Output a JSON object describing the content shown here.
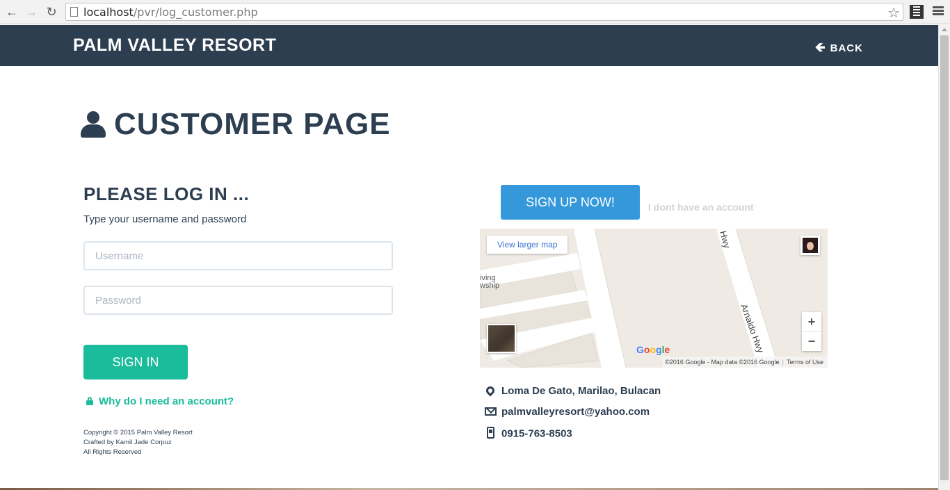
{
  "browser": {
    "url_host": "localhost",
    "url_path": "/pvr/log_customer.php"
  },
  "header": {
    "brand": "PALM VALLEY RESORT",
    "back_label": "BACK"
  },
  "page": {
    "title": "CUSTOMER PAGE"
  },
  "login": {
    "heading": "PLEASE LOG IN ...",
    "subtitle": "Type your username and password",
    "username_placeholder": "Username",
    "password_placeholder": "Password",
    "signin_label": "SIGN IN",
    "why_link": "Why do I need an account?"
  },
  "footer": {
    "line1": "Copyright © 2015 Palm Valley Resort",
    "line2": "Crafted by Kamil Jade Corpuz",
    "line3": "All Rights Reserved"
  },
  "signup": {
    "button_label": "SIGN UP NOW!",
    "no_account_text": "I dont have an account"
  },
  "map": {
    "view_larger": "View larger map",
    "road_label": "Arnaldo Hwy",
    "road_label_partial": "Hwy",
    "place_label_1": "iving",
    "place_label_2": "wship",
    "attribution": "©2016 Google - Map data ©2016 Google",
    "terms": "Terms of Use",
    "zoom_in": "+",
    "zoom_out": "−"
  },
  "contact": {
    "address": "Loma De Gato, Marilao, Bulacan",
    "email": "palmvalleyresort@yahoo.com",
    "phone": "0915-763-8503"
  },
  "colors": {
    "navy": "#2c3e50",
    "teal": "#1abc9c",
    "blue": "#3498db"
  }
}
